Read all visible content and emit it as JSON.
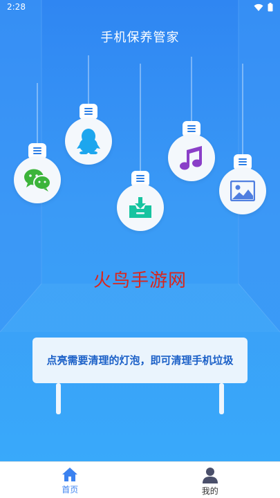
{
  "status_bar": {
    "time": "2:28",
    "icons": [
      "wifi-icon",
      "battery-icon"
    ]
  },
  "header": {
    "title": "手机保养管家"
  },
  "bulbs": [
    {
      "name": "wechat",
      "icon": "wechat-icon"
    },
    {
      "name": "qq",
      "icon": "qq-penguin-icon"
    },
    {
      "name": "download",
      "icon": "download-box-icon"
    },
    {
      "name": "music",
      "icon": "music-note-icon"
    },
    {
      "name": "image",
      "icon": "image-icon"
    }
  ],
  "watermark": "火鸟手游网",
  "tip": {
    "text": "点亮需要清理的灯泡，即可清理手机垃圾"
  },
  "tabs": [
    {
      "label": "首页",
      "icon": "home-icon",
      "active": true
    },
    {
      "label": "我的",
      "icon": "user-icon",
      "active": false
    }
  ],
  "colors": {
    "background_top": "#2f86f2",
    "background_bottom": "#39a9fa",
    "accent": "#3b82f0",
    "watermark": "#d9261c",
    "tip_text": "#1a5fc7"
  }
}
